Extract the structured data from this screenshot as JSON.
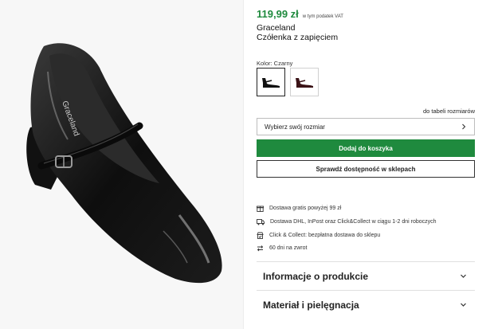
{
  "product": {
    "price": "119,99 zł",
    "vat_note": "w tym podatek VAT",
    "brand": "Graceland",
    "name": "Czółenka z zapięciem",
    "color_label": "Kolor: Czarny",
    "colors": [
      "Czarny",
      "Bordowy"
    ],
    "image_brand_print": "Graceland"
  },
  "size": {
    "table_link": "do tabeli rozmiarów",
    "select_label": "Wybierz swój rozmiar"
  },
  "actions": {
    "add_to_cart": "Dodaj do koszyka",
    "check_store": "Sprawdź dostępność w sklepach"
  },
  "features": [
    {
      "icon": "delivery-gift-icon",
      "text": "Dostawa gratis powyżej 99 zł"
    },
    {
      "icon": "truck-icon",
      "text": "Dostawa DHL, InPost oraz Click&Collect w ciągu 1-2 dni roboczych"
    },
    {
      "icon": "store-pickup-icon",
      "text": "Click & Collect: bezpłatna dostawa do sklepu"
    },
    {
      "icon": "return-arrows-icon",
      "text": "60 dni na zwrot"
    }
  ],
  "accordions": [
    {
      "label": "Informacje o produkcie"
    },
    {
      "label": "Materiał i pielęgnacja"
    }
  ],
  "colors": {
    "accent_green": "#1f8a3e",
    "text": "#222222",
    "border": "#bdbdbd"
  }
}
